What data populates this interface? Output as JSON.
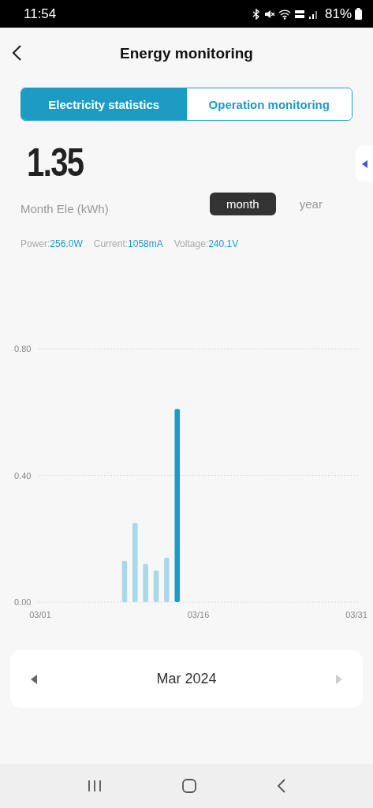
{
  "status_bar": {
    "time": "11:54",
    "battery": "81%"
  },
  "header": {
    "title": "Energy monitoring"
  },
  "tabs": [
    {
      "label": "Electricity statistics",
      "selected": true
    },
    {
      "label": "Operation monitoring",
      "selected": false
    }
  ],
  "summary": {
    "value": "1.35",
    "label": "Month Ele (kWh)"
  },
  "period_toggle": [
    {
      "label": "month",
      "selected": true
    },
    {
      "label": "year",
      "selected": false
    }
  ],
  "readings": [
    {
      "label": "Power:",
      "value": "256.0W"
    },
    {
      "label": "Current:",
      "value": "1058mA"
    },
    {
      "label": "Voltage:",
      "value": "240.1V"
    }
  ],
  "chart": {
    "chart_data": {
      "type": "bar",
      "categories": [
        "03/01",
        null,
        null,
        null,
        null,
        null,
        null,
        null,
        null,
        null,
        null,
        null,
        null,
        null,
        null,
        "03/16",
        null,
        null,
        null,
        null,
        null,
        null,
        null,
        null,
        null,
        null,
        null,
        null,
        null,
        null,
        "03/31"
      ],
      "series": [
        {
          "color": "#a9d8e6",
          "values": [
            null,
            null,
            null,
            null,
            null,
            null,
            null,
            null,
            0.13,
            0.25,
            0.12,
            0.1,
            0.14,
            null,
            null,
            null,
            null,
            null,
            null,
            null,
            null,
            null,
            null,
            null,
            null,
            null,
            null,
            null,
            null,
            null,
            null
          ]
        },
        {
          "color": "#1e9bc3",
          "values": [
            null,
            null,
            null,
            null,
            null,
            null,
            null,
            null,
            null,
            null,
            null,
            null,
            null,
            0.61,
            null,
            null,
            null,
            null,
            null,
            null,
            null,
            null,
            null,
            null,
            null,
            null,
            null,
            null,
            null,
            null,
            null
          ]
        }
      ],
      "ylim": [
        0,
        0.8
      ],
      "yticks": [
        {
          "value": 0,
          "label": "0.00"
        },
        {
          "value": 0.4,
          "label": "0.40"
        },
        {
          "value": 0.8,
          "label": "0.80"
        }
      ]
    }
  },
  "month_picker": {
    "label": "Mar 2024"
  }
}
